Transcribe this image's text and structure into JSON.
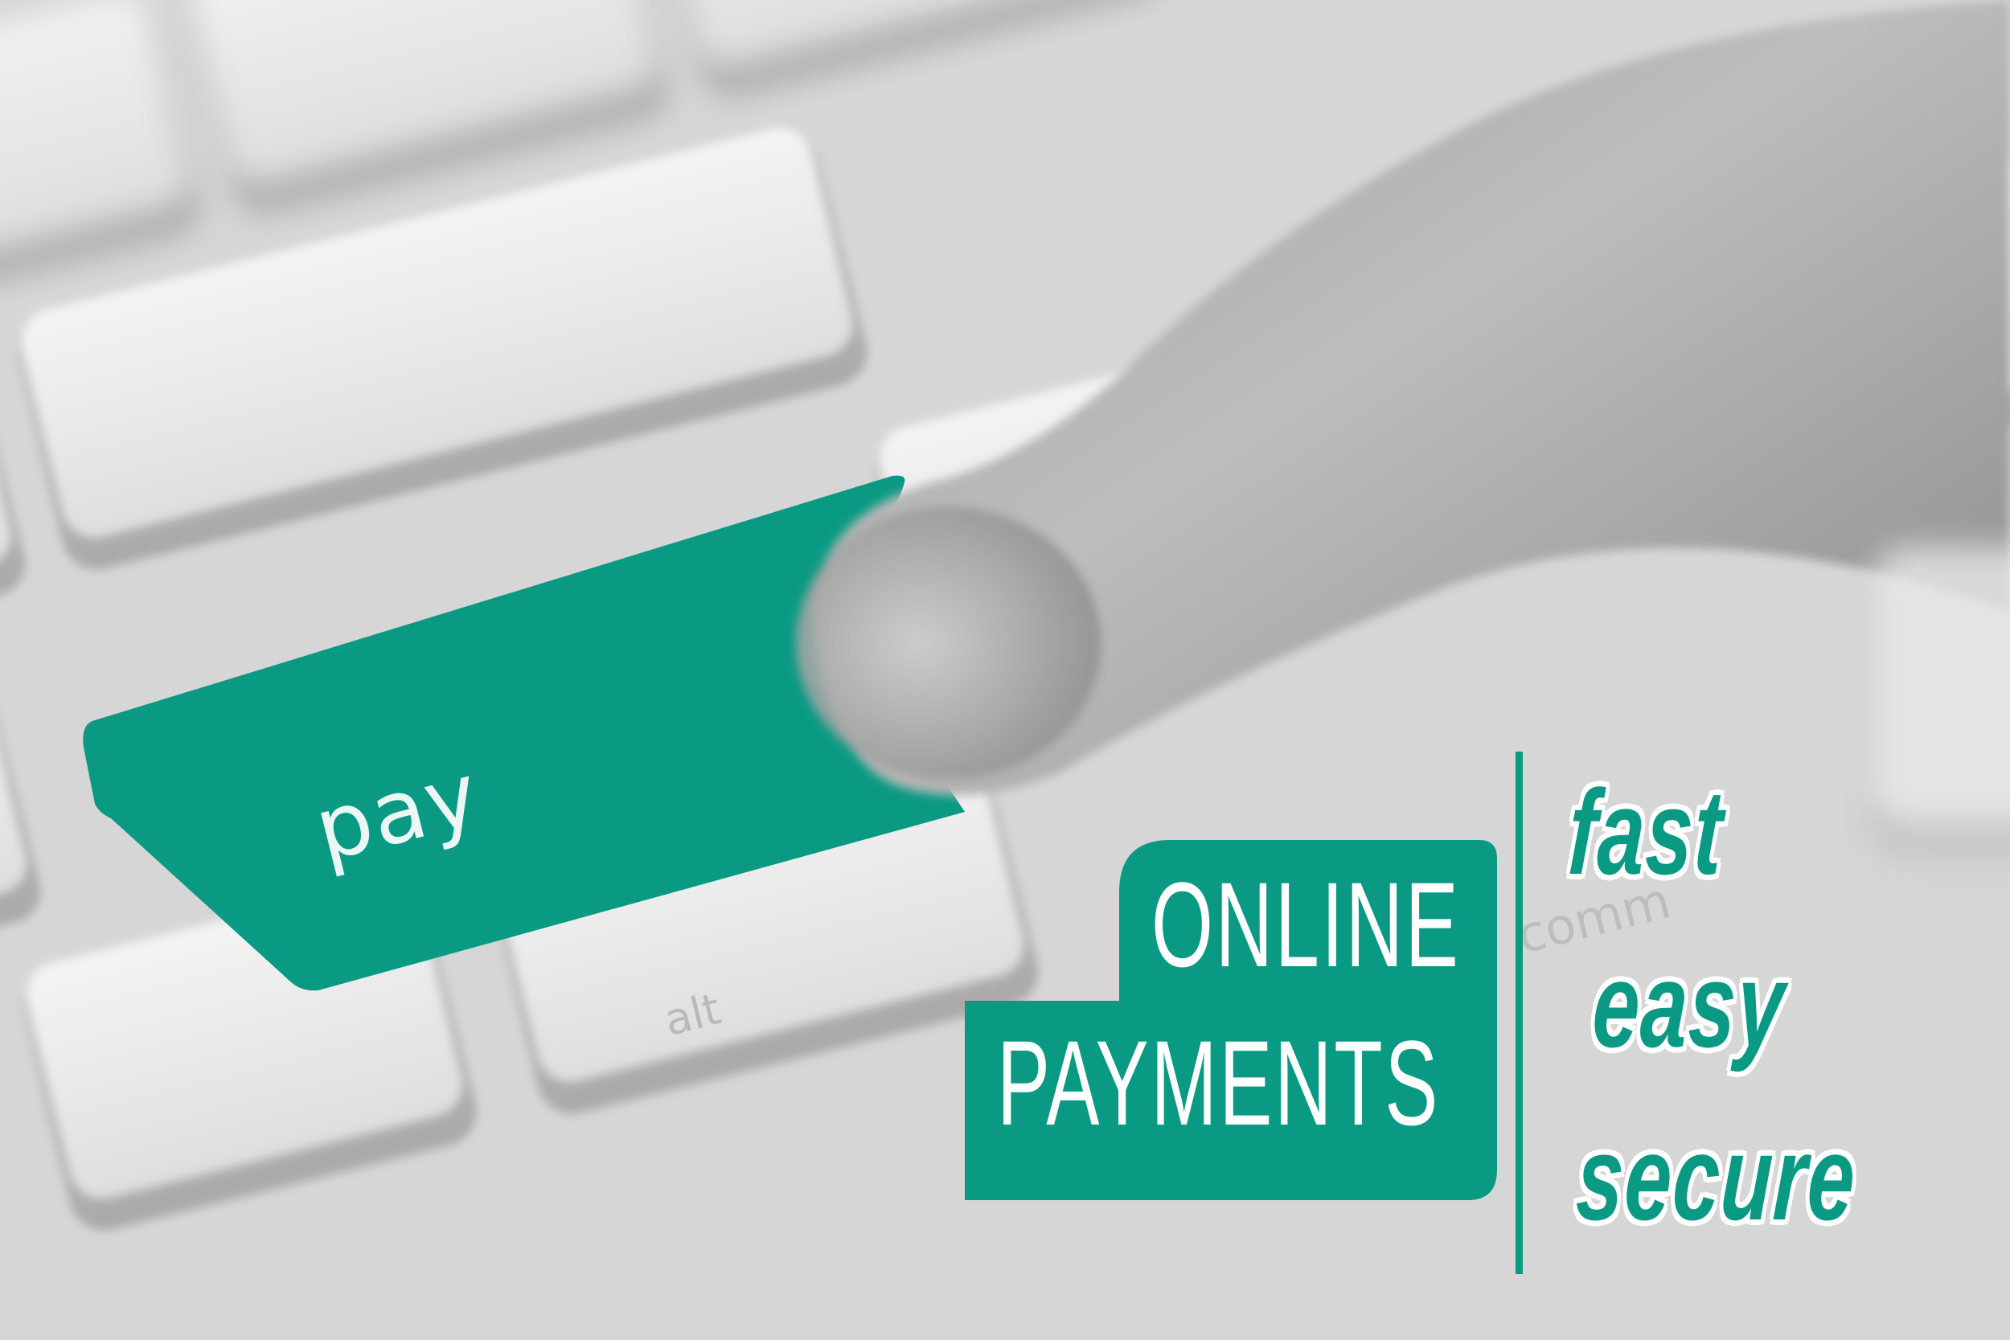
{
  "pay_key": {
    "label": "pay",
    "color": "#0a9a84"
  },
  "key_legends": {
    "alt": "alt",
    "command": "comm"
  },
  "headline": {
    "line_1": "ONLINE",
    "line_2": "PAYMENTS",
    "box_color": "#0a9a84",
    "text_color": "#ffffff"
  },
  "taglines": {
    "items": [
      "fast",
      "easy",
      "secure"
    ],
    "color": "#0a9a84",
    "outline_color": "#ffffff"
  }
}
